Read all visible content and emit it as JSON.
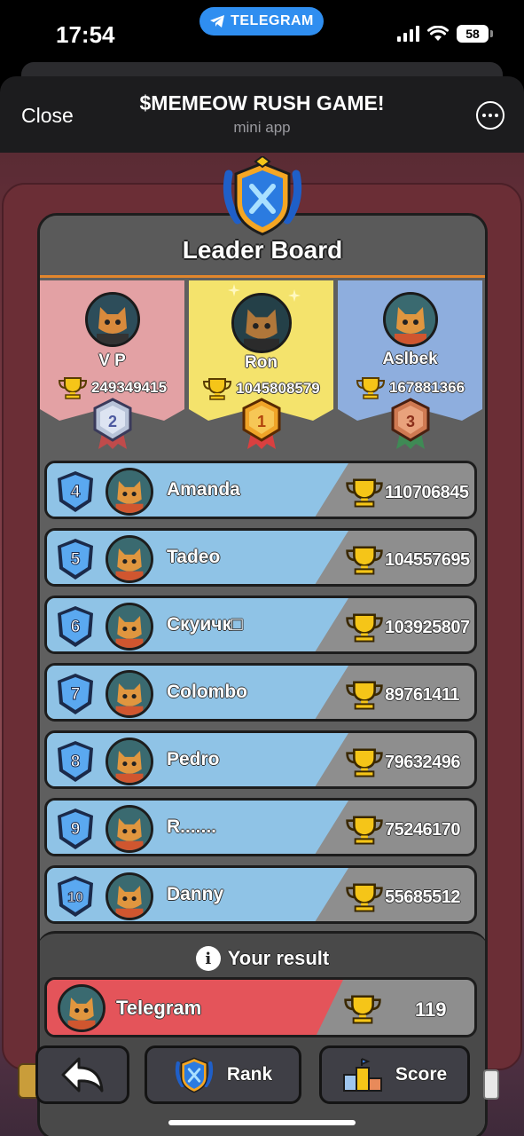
{
  "status_bar": {
    "time": "17:54",
    "pill_label": "TELEGRAM",
    "battery": "58",
    "icons": [
      "signal-icon",
      "wifi-icon",
      "battery-icon"
    ]
  },
  "header": {
    "close_label": "Close",
    "title": "$MEMEOW RUSH GAME!",
    "subtitle": "mini app",
    "more_icon": "more-icon"
  },
  "leaderboard": {
    "title": "Leader Board",
    "podium": [
      {
        "rank": "2",
        "name": "V P",
        "score": "249349415",
        "color": "#e3a1a4"
      },
      {
        "rank": "1",
        "name": "Ron",
        "score": "1045808579",
        "color": "#f4e36c"
      },
      {
        "rank": "3",
        "name": "Aslbek",
        "score": "167881366",
        "color": "#8eaede"
      }
    ],
    "rows": [
      {
        "rank": "4",
        "name": "Amanda",
        "score": "110706845"
      },
      {
        "rank": "5",
        "name": "Tadeo",
        "score": "104557695"
      },
      {
        "rank": "6",
        "name": "Скуичк□",
        "score": "103925807"
      },
      {
        "rank": "7",
        "name": "Colombo",
        "score": "89761411"
      },
      {
        "rank": "8",
        "name": "Pedro",
        "score": "79632496"
      },
      {
        "rank": "9",
        "name": "R.......",
        "score": "75246170"
      },
      {
        "rank": "10",
        "name": "Danny",
        "score": "55685512"
      }
    ]
  },
  "your_result": {
    "heading": "Your result",
    "info_icon": "i",
    "name": "Telegram",
    "score": "119",
    "color": "#e4545a"
  },
  "nav": {
    "back_icon": "back-arrow-icon",
    "rank_label": "Rank",
    "score_label": "Score"
  },
  "colors": {
    "panel": "#5f5f5f",
    "row_blue": "#8fc3e6",
    "accent_orange": "#e2862c",
    "telegram_blue": "#2f8ef0"
  }
}
